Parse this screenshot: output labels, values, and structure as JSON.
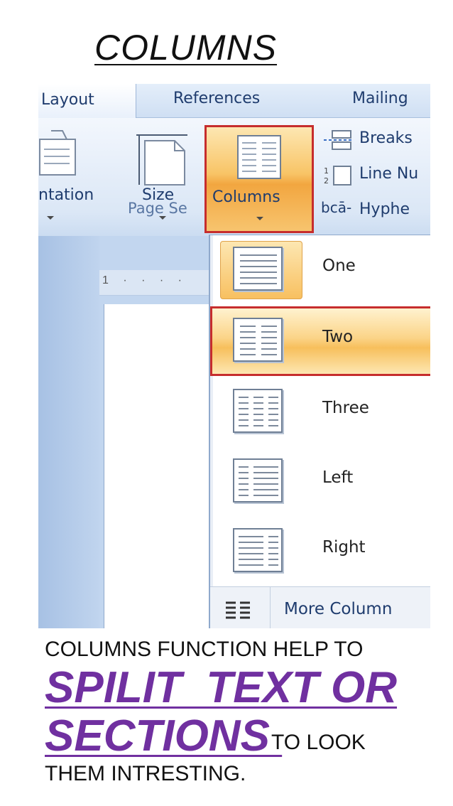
{
  "title": "COLUMNS",
  "tabs": [
    "Layout",
    "References",
    "Mailing"
  ],
  "ribbon": {
    "orientation_label": "ntation",
    "size_label": "Size",
    "columns_label": "Columns",
    "group_label": "Page Se",
    "small_items": [
      "Breaks",
      "Line Nu",
      "Hyphe"
    ],
    "hyphen_icon_text": "bcā-",
    "ruler_marks": "1 · · · ·"
  },
  "columns_menu": {
    "items": [
      "One",
      "Two",
      "Three",
      "Left",
      "Right"
    ],
    "more_label": "More Column"
  },
  "caption": {
    "line1": "COLUMNS FUNCTION HELP TO",
    "big_line1": "SPILIT  TEXT OR",
    "big_line2": "SECTIONS ",
    "tail1": "TO LOOK",
    "tail2": "THEM INTRESTING."
  },
  "colors": {
    "accent_purple": "#7030a0",
    "highlight_red": "#c62d2d",
    "ribbon_blue": "#1f3c6e",
    "menu_orange": "#f8c466"
  }
}
